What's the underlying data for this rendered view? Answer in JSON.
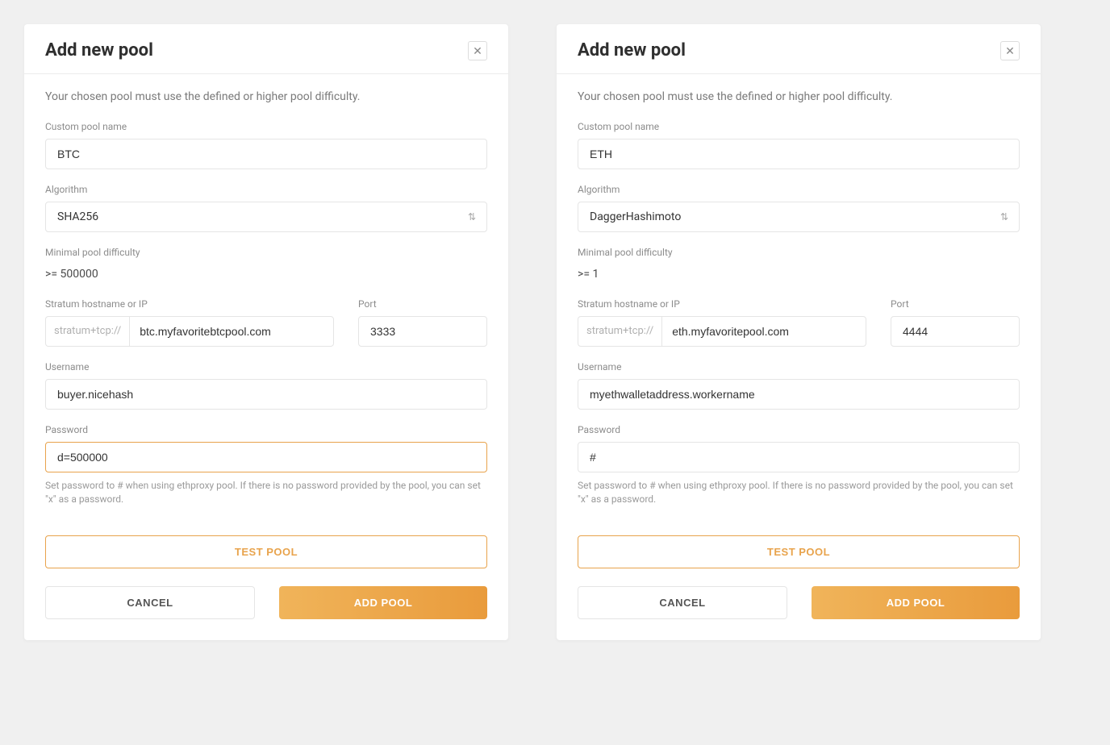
{
  "left": {
    "title": "Add new pool",
    "description": "Your chosen pool must use the defined or higher pool difficulty.",
    "labels": {
      "custom_pool_name": "Custom pool name",
      "algorithm": "Algorithm",
      "min_difficulty": "Minimal pool difficulty",
      "hostname": "Stratum hostname or IP",
      "port": "Port",
      "username": "Username",
      "password": "Password"
    },
    "values": {
      "custom_pool_name": "BTC",
      "algorithm": "SHA256",
      "min_difficulty": ">= 500000",
      "stratum_prefix": "stratum+tcp://",
      "hostname": "btc.myfavoritebtcpool.com",
      "port": "3333",
      "username": "buyer.nicehash",
      "password": "d=500000"
    },
    "password_hint": "Set password to # when using ethproxy pool. If there is no password provided by the pool, you can set \"x\" as a password.",
    "buttons": {
      "test": "TEST POOL",
      "cancel": "CANCEL",
      "add": "ADD POOL"
    }
  },
  "right": {
    "title": "Add new pool",
    "description": "Your chosen pool must use the defined or higher pool difficulty.",
    "labels": {
      "custom_pool_name": "Custom pool name",
      "algorithm": "Algorithm",
      "min_difficulty": "Minimal pool difficulty",
      "hostname": "Stratum hostname or IP",
      "port": "Port",
      "username": "Username",
      "password": "Password"
    },
    "values": {
      "custom_pool_name": "ETH",
      "algorithm": "DaggerHashimoto",
      "min_difficulty": ">= 1",
      "stratum_prefix": "stratum+tcp://",
      "hostname": "eth.myfavoritepool.com",
      "port": "4444",
      "username": "myethwalletaddress.workername",
      "password": "#"
    },
    "password_hint": "Set password to # when using ethproxy pool. If there is no password provided by the pool, you can set \"x\" as a password.",
    "buttons": {
      "test": "TEST POOL",
      "cancel": "CANCEL",
      "add": "ADD POOL"
    }
  }
}
